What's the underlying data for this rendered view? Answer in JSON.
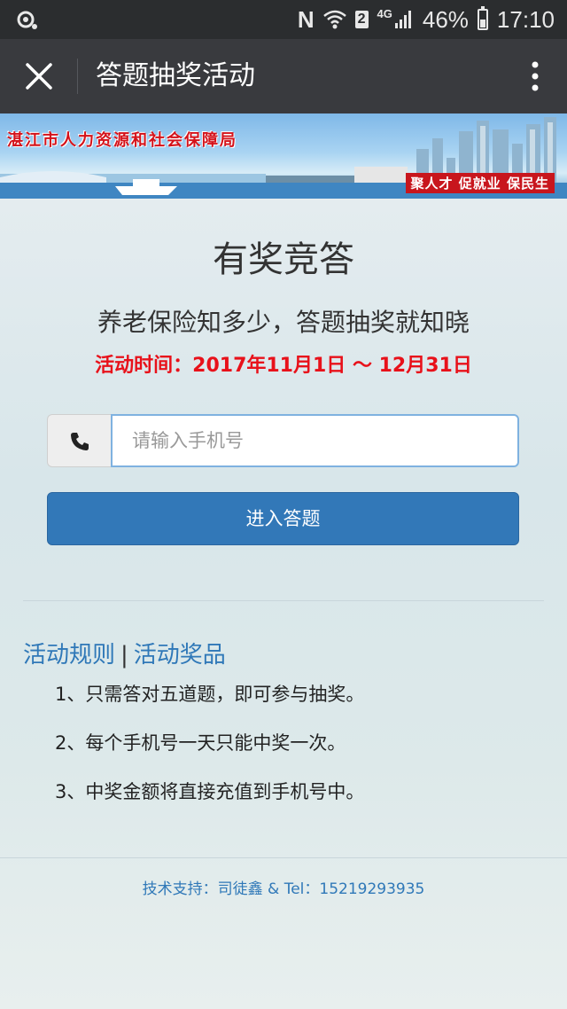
{
  "status_bar": {
    "battery": "46%",
    "time": "17:10",
    "sim_slot": "2",
    "network": "4G",
    "nfc_label": "N"
  },
  "nav": {
    "title": "答题抽奖活动"
  },
  "banner": {
    "organization": "湛江市人力资源和社会保障局",
    "slogan": "聚人才 促就业 保民生"
  },
  "main": {
    "heading": "有奖竞答",
    "subtitle": "养老保险知多少，答题抽奖就知晓",
    "period": "活动时间：2017年11月1日 ～ 12月31日",
    "phone_placeholder": "请输入手机号",
    "submit_label": "进入答题",
    "links": {
      "rules": "活动规则",
      "separator": "|",
      "prizes": "活动奖品"
    },
    "rules": [
      "1、只需答对五道题，即可参与抽奖。",
      "2、每个手机号一天只能中奖一次。",
      "3、中奖金额将直接充值到手机号中。"
    ],
    "footer": "技术支持：司徒鑫 & Tel：15219293935"
  },
  "colors": {
    "accent_blue": "#3278b8",
    "link_blue": "#2f78b8",
    "period_red": "#e8111a",
    "navbar_bg": "#393a3e"
  },
  "icons": [
    "settings-gear-icon",
    "wifi-icon",
    "signal-icon",
    "battery-icon",
    "close-icon",
    "more-vertical-icon",
    "phone-icon"
  ]
}
